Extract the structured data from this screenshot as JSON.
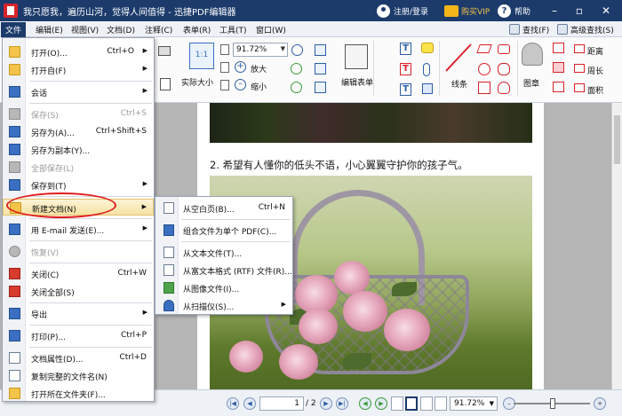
{
  "titlebar": {
    "title": "我只愿我，遍历山河，觉得人间值得 - 迅捷PDF编辑器",
    "login": "注册/登录",
    "vip": "购买VIP",
    "help": "帮助"
  },
  "menubar": {
    "items": [
      "文件",
      "编辑(E)",
      "视图(V)",
      "文档(D)",
      "注释(C)",
      "表单(R)",
      "工具(T)",
      "窗口(W)"
    ],
    "find": "查找(F)",
    "advanced_find": "高级查找(S)"
  },
  "ribbon": {
    "zoom_value": "91.72%",
    "actual_size": "实际大小",
    "zoom_in": "放大",
    "zoom_out": "缩小",
    "edit_form": "编辑表单",
    "lines": "线条",
    "stamp": "图章",
    "distance": "距离",
    "perimeter": "周长",
    "area": "面积"
  },
  "document": {
    "line": "2. 希望有人懂你的低头不语，小心翼翼守护你的孩子气。"
  },
  "file_menu": {
    "items": [
      {
        "label": "打开(O)...",
        "shortcut": "Ctrl+O",
        "submenu": true,
        "disabled": false
      },
      {
        "label": "打开自(F)",
        "shortcut": "",
        "submenu": true,
        "disabled": false
      },
      {
        "label": "会话",
        "shortcut": "",
        "submenu": true,
        "disabled": false
      },
      {
        "label": "保存(S)",
        "shortcut": "Ctrl+S",
        "submenu": false,
        "disabled": true
      },
      {
        "label": "另存为(A)...",
        "shortcut": "Ctrl+Shift+S",
        "submenu": false,
        "disabled": false
      },
      {
        "label": "另存为副本(Y)...",
        "shortcut": "",
        "submenu": false,
        "disabled": false
      },
      {
        "label": "全部保存(L)",
        "shortcut": "",
        "submenu": false,
        "disabled": true
      },
      {
        "label": "保存到(T)",
        "shortcut": "",
        "submenu": true,
        "disabled": false
      },
      {
        "label": "新建文档(N)",
        "shortcut": "",
        "submenu": true,
        "disabled": false
      },
      {
        "label": "用 E-mail 发送(E)...",
        "shortcut": "",
        "submenu": true,
        "disabled": false
      },
      {
        "label": "恢复(V)",
        "shortcut": "",
        "submenu": false,
        "disabled": true
      },
      {
        "label": "关闭(C)",
        "shortcut": "Ctrl+W",
        "submenu": false,
        "disabled": false
      },
      {
        "label": "关闭全部(S)",
        "shortcut": "",
        "submenu": false,
        "disabled": false
      },
      {
        "label": "导出",
        "shortcut": "",
        "submenu": true,
        "disabled": false
      },
      {
        "label": "打印(P)...",
        "shortcut": "Ctrl+P",
        "submenu": false,
        "disabled": false
      },
      {
        "label": "文档属性(D)...",
        "shortcut": "Ctrl+D",
        "submenu": false,
        "disabled": false
      },
      {
        "label": "复制完整的文件名(N)",
        "shortcut": "",
        "submenu": false,
        "disabled": false
      },
      {
        "label": "打开所在文件夹(F)...",
        "shortcut": "",
        "submenu": false,
        "disabled": false
      }
    ]
  },
  "new_doc_menu": {
    "items": [
      {
        "label": "从空白页(B)...",
        "shortcut": "Ctrl+N",
        "submenu": false
      },
      {
        "label": "组合文件为单个 PDF(C)...",
        "shortcut": "",
        "submenu": false
      },
      {
        "label": "从文本文件(T)...",
        "shortcut": "",
        "submenu": false
      },
      {
        "label": "从富文本格式 (RTF) 文件(R)...",
        "shortcut": "",
        "submenu": false
      },
      {
        "label": "从图像文件(I)...",
        "shortcut": "",
        "submenu": false
      },
      {
        "label": "从扫描仪(S)...",
        "shortcut": "",
        "submenu": true
      }
    ]
  },
  "statusbar": {
    "page_current": "1",
    "page_total": "/ 2",
    "zoom_value": "91.72%"
  },
  "colors": {
    "titlebar": "#1c3b6b",
    "highlight": "#f8e3a4",
    "annotation_circle": "#e01e1e",
    "accent_red": "#d8232a"
  }
}
